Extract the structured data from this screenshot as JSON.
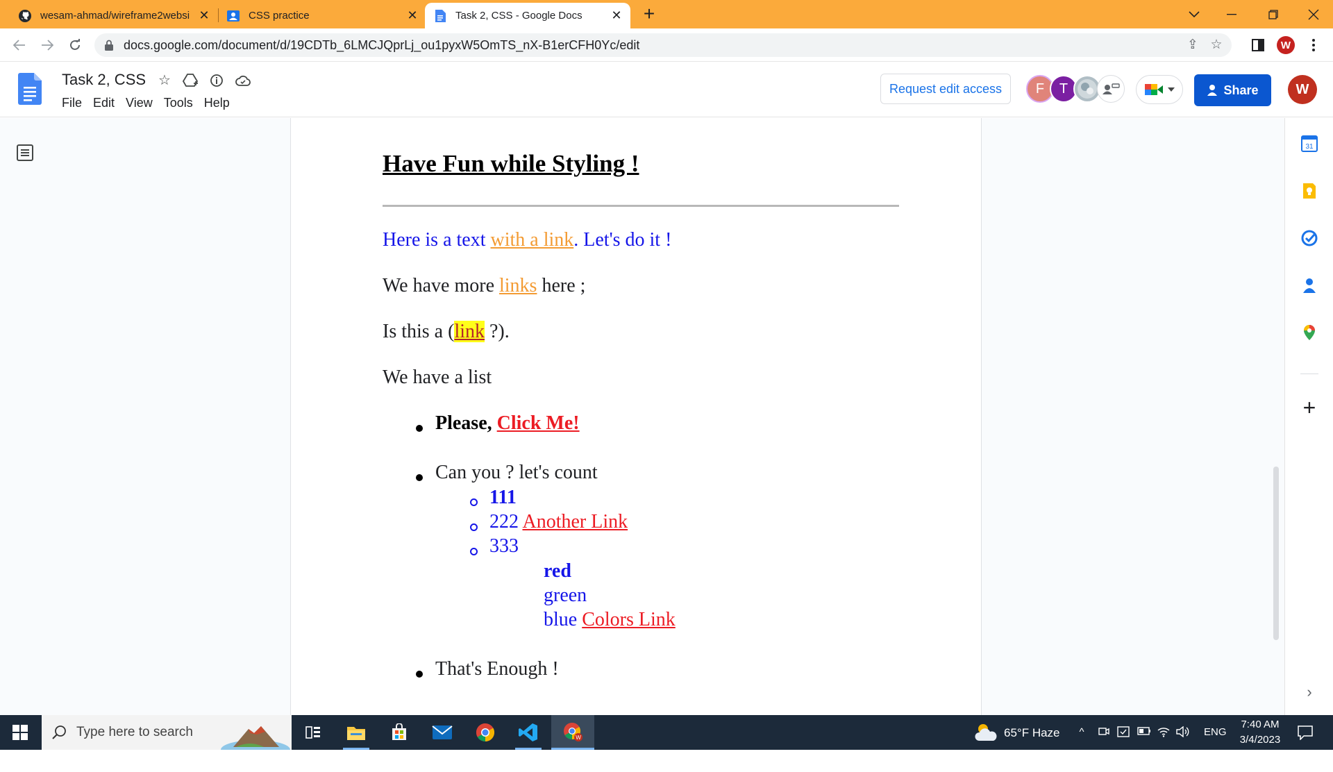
{
  "browser": {
    "tabs": [
      {
        "title": "wesam-ahmad/wireframe2websi",
        "icon": "github-icon",
        "active": false
      },
      {
        "title": "CSS practice",
        "icon": "classroom-icon",
        "active": false
      },
      {
        "title": "Task 2, CSS - Google Docs",
        "icon": "docs-icon",
        "active": true
      }
    ],
    "new_tab_label": "+",
    "url": "docs.google.com/document/d/19CDTb_6LMCJQprLj_ou1pyxW5OmTS_nX-B1erCFH0Yc/edit",
    "profile_initial": "W",
    "tabstrip_color": "#fbaa3b"
  },
  "docs": {
    "title": "Task 2, CSS",
    "menu": [
      "File",
      "Edit",
      "View",
      "Tools",
      "Help"
    ],
    "request_edit_label": "Request edit access",
    "share_label": "Share",
    "account_initial": "W",
    "collaborators": [
      {
        "initial": "F",
        "color": "#e0847a"
      },
      {
        "initial": "T",
        "color": "#7b1fa2"
      },
      {
        "initial": "",
        "color": "#b0bec5"
      },
      {
        "initial": "",
        "color": "#ffffff"
      }
    ],
    "colors": {
      "share": "#0b57d0",
      "request": "#1a73e8",
      "account": "#c0301f"
    }
  },
  "content": {
    "heading": "Have Fun while Styling !",
    "p1": {
      "before": "Here is a text ",
      "link": "with a link",
      "after": ". Let's do it !"
    },
    "p2": {
      "before": "We have more ",
      "link": "links",
      "after": " here ;"
    },
    "p3": {
      "before": "Is this a (",
      "link": "link",
      "after": " ?)."
    },
    "p4": "We have a list",
    "list": {
      "item1": {
        "bold": "Please, ",
        "link": "Click Me!"
      },
      "item2": "Can you ? let's count",
      "sub": [
        {
          "text": "111"
        },
        {
          "text": "222 ",
          "link": "Another Link"
        },
        {
          "text": "333"
        }
      ],
      "colors": {
        "red": "red",
        "green": "green",
        "blue": "blue ",
        "link": "Colors Link"
      },
      "item3": "That's Enough !"
    },
    "colors": {
      "blue_text": "#1515e8",
      "orange_link": "#f39b33",
      "red_link": "#ec1c24",
      "highlight": "#ffff1a"
    }
  },
  "taskbar": {
    "search_placeholder": "Type here to search",
    "weather": "65°F  Haze",
    "language": "ENG",
    "time": "7:40 AM",
    "date": "3/4/2023"
  }
}
